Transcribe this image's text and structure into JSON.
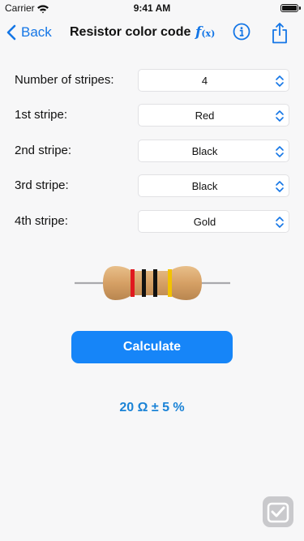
{
  "status_bar": {
    "carrier": "Carrier",
    "time": "9:41 AM"
  },
  "nav": {
    "back_label": "Back",
    "title": "Resistor color code",
    "fx_label": "f",
    "fx_sub": "(x)"
  },
  "form": {
    "rows": [
      {
        "label": "Number of stripes:",
        "value": "4"
      },
      {
        "label": "1st stripe:",
        "value": "Red"
      },
      {
        "label": "2nd stripe:",
        "value": "Black"
      },
      {
        "label": "3rd stripe:",
        "value": "Black"
      },
      {
        "label": "4th stripe:",
        "value": "Gold"
      }
    ]
  },
  "resistor": {
    "body_color": "#d8a56b",
    "band_colors": [
      "#e0191f",
      "#111111",
      "#111111",
      "#f2c200"
    ]
  },
  "calculate_label": "Calculate",
  "result": "20 Ω ± 5 %",
  "colors": {
    "accent": "#1476e6",
    "button": "#1685f8",
    "result": "#1b83d6"
  }
}
